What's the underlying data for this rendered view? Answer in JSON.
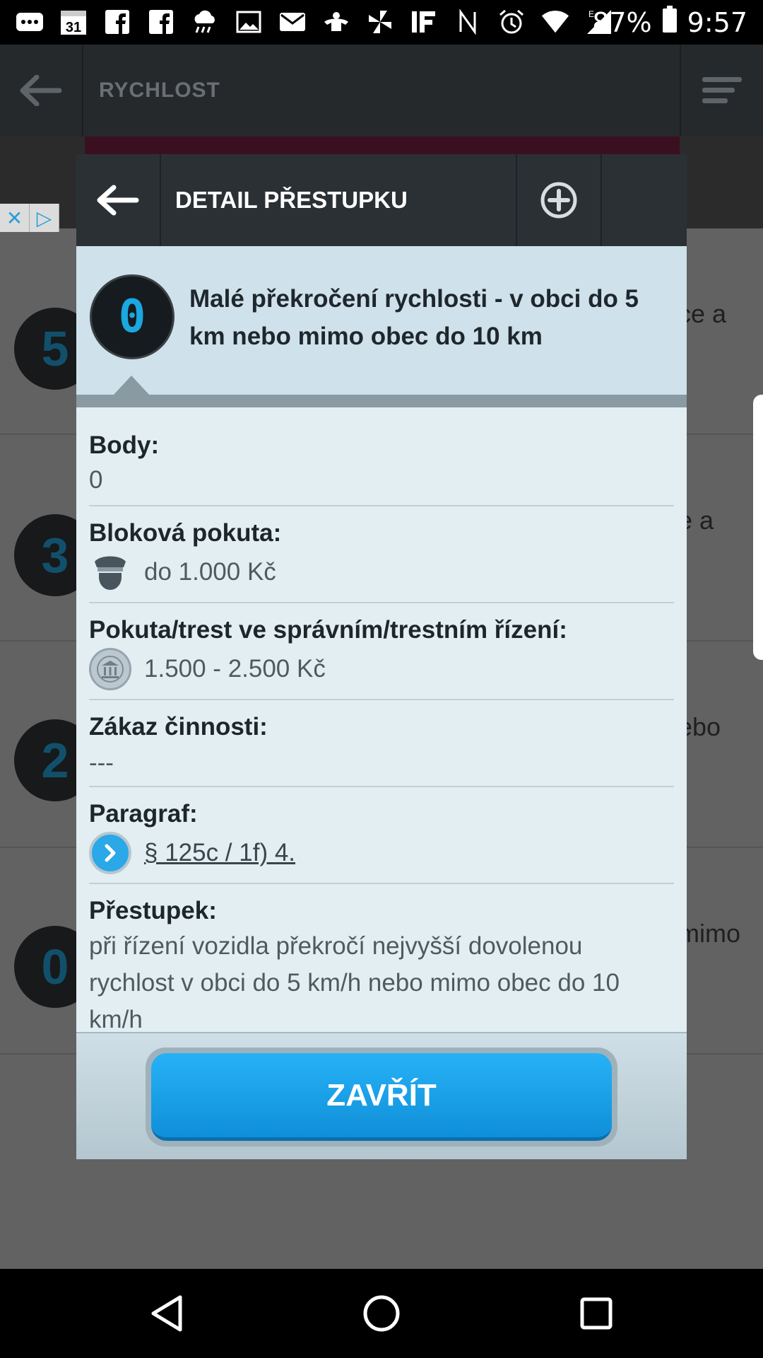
{
  "status_bar": {
    "battery": "87%",
    "time": "9:57",
    "calendar_day": "31",
    "icons": [
      "more-icon",
      "calendar-icon",
      "facebook-icon",
      "facebook-icon",
      "weather-icon",
      "image-icon",
      "mail-icon",
      "person-icon",
      "pinwheel-icon",
      "if-icon",
      "nfc-icon",
      "alarm-icon",
      "wifi-icon",
      "signal-icon",
      "battery-icon"
    ]
  },
  "background": {
    "title": "RYCHLOST",
    "rows": [
      {
        "badge": "5",
        "text": "ce a"
      },
      {
        "badge": "3",
        "text": "e a"
      },
      {
        "badge": "2",
        "text": "ebo"
      },
      {
        "badge": "0",
        "text": "mimo"
      }
    ]
  },
  "dialog": {
    "title": "DETAIL PŘESTUPKU",
    "badge": "0",
    "summary": "Malé překročení rychlosti - v obci do 5 km nebo mimo obec do 10 km",
    "fields": {
      "body_label": "Body:",
      "body_value": "0",
      "block_fine_label": "Bloková pokuta:",
      "block_fine_value": "do 1.000 Kč",
      "admin_fine_label": "Pokuta/trest ve správním/trestním řízení:",
      "admin_fine_value": "1.500 - 2.500 Kč",
      "ban_label": "Zákaz činnosti:",
      "ban_value": "---",
      "paragraph_label": "Paragraf:",
      "paragraph_value": "§ 125c / 1f) 4.",
      "offense_label": "Přestupek:",
      "offense_value": "při řízení vozidla překročí nejvyšší dovolenou rychlost v obci do 5 km/h nebo mimo obec do 10 km/h"
    },
    "close_label": "ZAVŘÍT"
  },
  "colors": {
    "accent": "#1ba7e0",
    "header": "#2b3035",
    "dialog_bg": "#e3eef3"
  }
}
